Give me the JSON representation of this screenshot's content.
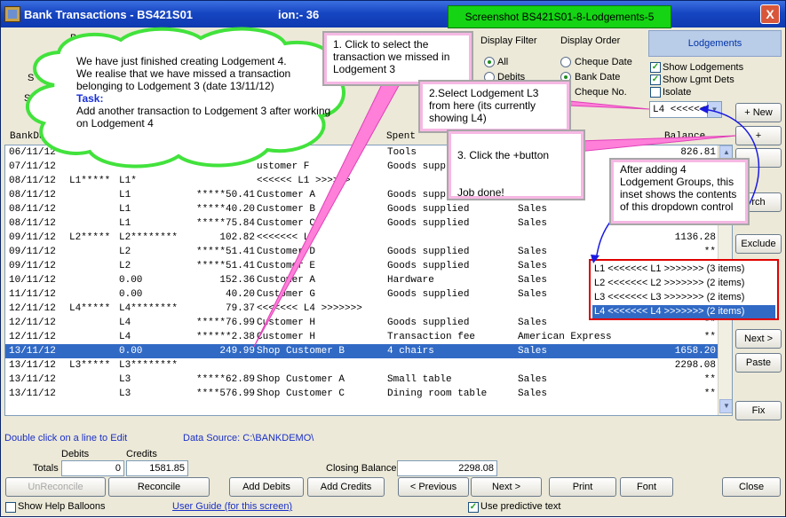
{
  "window": {
    "title": "Bank Transactions - BS421S01",
    "title_partial": "ion:-  36",
    "close_glyph": "X"
  },
  "screenshot_tag": "Screenshot BS421S01-8-Lodgements-5",
  "partial_labels": {
    "bank": "Bank",
    "s1": "S",
    "s2": "S"
  },
  "display_filter": {
    "title": "Display Filter",
    "options": [
      {
        "label": "All",
        "selected": true
      },
      {
        "label": "Debits",
        "selected": false
      }
    ]
  },
  "display_order": {
    "title": "Display Order",
    "options": [
      {
        "label": "Cheque Date",
        "selected": false
      },
      {
        "label": "Bank Date",
        "selected": true
      },
      {
        "label": "Cheque No.",
        "selected": false
      }
    ]
  },
  "lodgements_panel": {
    "tab_label": "Lodgements",
    "checkboxes": [
      {
        "label": "Show Lodgements",
        "checked": true
      },
      {
        "label": "Show Lgmt Dets",
        "checked": true
      },
      {
        "label": "Isolate",
        "checked": false
      }
    ],
    "dropdown_value": "L4 <<<<<<",
    "new_button": "+ New"
  },
  "side_buttons": {
    "plus": "+",
    "search": "rch",
    "exclude": "Exclude",
    "next": "Next >",
    "paste": "Paste",
    "fix": "Fix"
  },
  "table": {
    "headers": {
      "bankdate": "BankDa",
      "spent": "Spent",
      "balance": "Balance"
    },
    "rows": [
      {
        "c1": "06/11/12",
        "c2": "",
        "c3": "",
        "c4": "",
        "c5": "",
        "c6": "Tools",
        "c7": "",
        "c8": "826.81",
        "selected": false
      },
      {
        "c1": "07/11/12",
        "c2": "",
        "c3": "",
        "c4": "",
        "c5": "ustomer F",
        "c6": "Goods suppli",
        "c7": "",
        "c8": "",
        "selected": false
      },
      {
        "c1": "08/11/12",
        "c2": "L1*****",
        "c3": "L1*",
        "c4": "",
        "c5": "<<<<<< L1 >>>>>>",
        "c6": "",
        "c7": "",
        "c8": "",
        "selected": false
      },
      {
        "c1": "08/11/12",
        "c2": "",
        "c3": "L1",
        "c4": "*****50.41",
        "c5": "Customer A",
        "c6": "Goods suppl",
        "c7": "",
        "c8": "",
        "selected": false
      },
      {
        "c1": "08/11/12",
        "c2": "",
        "c3": "L1",
        "c4": "*****40.20",
        "c5": "Customer B",
        "c6": "Goods supplied",
        "c7": "Sales",
        "c8": "",
        "selected": false
      },
      {
        "c1": "08/11/12",
        "c2": "",
        "c3": "L1",
        "c4": "*****75.84",
        "c5": "Customer C",
        "c6": "Goods supplied",
        "c7": "Sales",
        "c8": "",
        "selected": false
      },
      {
        "c1": "09/11/12",
        "c2": "L2*****",
        "c3": "L2********",
        "c4": "102.82",
        "c5": "<<<<<<< L",
        "c6": "",
        "c7": "",
        "c8": "1136.28",
        "selected": false
      },
      {
        "c1": "09/11/12",
        "c2": "",
        "c3": "L2",
        "c4": "*****51.41",
        "c5": "Customer D",
        "c6": "Goods supplied",
        "c7": "Sales",
        "c8": "**",
        "selected": false
      },
      {
        "c1": "09/11/12",
        "c2": "",
        "c3": "L2",
        "c4": "*****51.41",
        "c5": "Customer E",
        "c6": "Goods supplied",
        "c7": "Sales",
        "c8": "**",
        "selected": false
      },
      {
        "c1": "10/11/12",
        "c2": "",
        "c3": "0.00",
        "c4": "152.36",
        "c5": "Customer A",
        "c6": "Hardware",
        "c7": "Sales",
        "c8": "**",
        "selected": false
      },
      {
        "c1": "11/11/12",
        "c2": "",
        "c3": "0.00",
        "c4": "40.20",
        "c5": "Customer G",
        "c6": "Goods supplied",
        "c7": "Sales",
        "c8": "**",
        "selected": false
      },
      {
        "c1": "12/11/12",
        "c2": "L4*****",
        "c3": "L4********",
        "c4": "79.37",
        "c5": "<<<<<<< L4 >>>>>>>",
        "c6": "",
        "c7": "",
        "c8": "",
        "selected": false
      },
      {
        "c1": "12/11/12",
        "c2": "",
        "c3": "L4",
        "c4": "*****76.99",
        "c5": "Customer H",
        "c6": "Goods supplied",
        "c7": "Sales",
        "c8": "**",
        "selected": false
      },
      {
        "c1": "12/11/12",
        "c2": "",
        "c3": "L4",
        "c4": "******2.38",
        "c5": "Customer H",
        "c6": "Transaction fee",
        "c7": "American Express",
        "c8": "**",
        "selected": false
      },
      {
        "c1": "13/11/12",
        "c2": "",
        "c3": "0.00",
        "c4": "249.99",
        "c5": "Shop Customer B",
        "c6": "4 chairs",
        "c7": "Sales",
        "c8": "1658.20",
        "selected": true
      },
      {
        "c1": "13/11/12",
        "c2": "L3*****",
        "c3": "L3********",
        "c4": "",
        "c5": "",
        "c6": "",
        "c7": "",
        "c8": "2298.08",
        "selected": false
      },
      {
        "c1": "13/11/12",
        "c2": "",
        "c3": "L3",
        "c4": "*****62.89",
        "c5": "Shop Customer A",
        "c6": "Small table",
        "c7": "Sales",
        "c8": "**",
        "selected": false
      },
      {
        "c1": "13/11/12",
        "c2": "",
        "c3": "L3",
        "c4": "****576.99",
        "c5": "Shop Customer C",
        "c6": "Dining room table",
        "c7": "Sales",
        "c8": "**",
        "selected": false
      }
    ]
  },
  "inset": {
    "items": [
      {
        "label": "L1 <<<<<<< L1 >>>>>>> (3 items)",
        "selected": false
      },
      {
        "label": "L2 <<<<<<< L2 >>>>>>> (2 items)",
        "selected": false
      },
      {
        "label": "L3 <<<<<<< L3 >>>>>>> (2 items)",
        "selected": false
      },
      {
        "label": "L4 <<<<<<< L4 >>>>>>> (2 items)",
        "selected": true
      }
    ]
  },
  "callouts": {
    "cloud_line1": "We have just finished creating Lodgement 4.",
    "cloud_line2": "We realise that we have missed a transaction belonging to Lodgement 3 (date 13/11/12)",
    "cloud_task_label": "Task:",
    "cloud_task_text": "Add another transaction to Lodgement 3 after working on Lodgement 4",
    "step1": "1. Click to select the transaction we missed in Lodgement 3",
    "step2": "2.Select Lodgement L3 from here (its currently showing L4)",
    "step3_title": "3. Click the +button",
    "step3_done": "Job done!",
    "inset_note": "After adding 4 Lodgement Groups, this inset shows the contents of this dropdown control"
  },
  "footer": {
    "double_click_hint": "Double click on a line to Edit",
    "data_source": "Data Source: C:\\BANKDEMO\\",
    "debits_label": "Debits",
    "credits_label": "Credits",
    "totals_label": "Totals",
    "debits_value": "0",
    "credits_value": "1581.85",
    "closing_balance_label": "Closing Balance",
    "closing_balance_value": "2298.08",
    "buttons": {
      "unreconcile": "UnReconcile",
      "reconcile": "Reconcile",
      "add_debits": "Add Debits",
      "add_credits": "Add Credits",
      "previous": "< Previous",
      "next": "Next >",
      "print": "Print",
      "font": "Font",
      "close": "Close"
    },
    "show_help_balloons": "Show Help Balloons",
    "user_guide": "User Guide (for this screen)",
    "use_predictive_text": "Use predictive text"
  }
}
